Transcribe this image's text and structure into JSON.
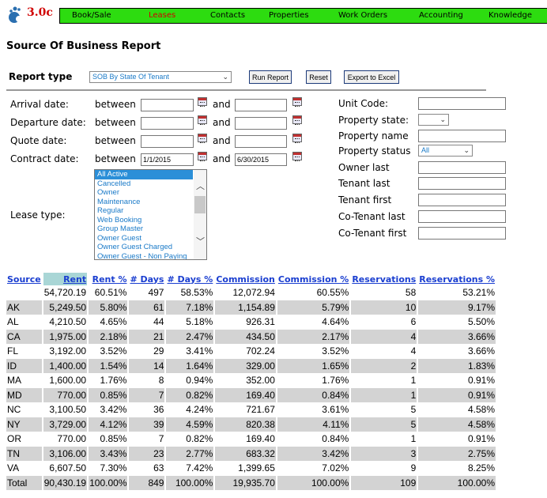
{
  "app": {
    "version": "3.0c"
  },
  "nav": [
    {
      "label": "Book/Sale"
    },
    {
      "label": "Leases",
      "active": true
    },
    {
      "label": "Contacts"
    },
    {
      "label": "Properties"
    },
    {
      "label": "Work Orders"
    },
    {
      "label": "Accounting"
    },
    {
      "label": "Knowledge"
    }
  ],
  "page_title": "Source Of Business Report",
  "report_type": {
    "label": "Report type",
    "value": "SOB By State Of Tenant",
    "run": "Run Report",
    "reset": "Reset",
    "export": "Export to Excel"
  },
  "dates": {
    "between": "between",
    "and": "and",
    "rows": [
      {
        "label": "Arrival date:",
        "from": "",
        "to": ""
      },
      {
        "label": "Departure date:",
        "from": "",
        "to": ""
      },
      {
        "label": "Quote date:",
        "from": "",
        "to": ""
      },
      {
        "label": "Contract date:",
        "from": "1/1/2015",
        "to": "6/30/2015"
      }
    ]
  },
  "lease_type": {
    "label": "Lease type:",
    "options": [
      "All Active",
      "Cancelled",
      "Owner",
      "Maintenance",
      "Regular",
      "Web Booking",
      "Group Master",
      "Owner Guest",
      "Owner Guest Charged",
      "Owner Guest - Non Paying"
    ],
    "selected": "All Active"
  },
  "right_fields": {
    "unit_code": "Unit Code:",
    "property_state": "Property state:",
    "property_name": "Property name",
    "property_status": "Property status",
    "property_status_value": "All",
    "owner_last": "Owner last",
    "tenant_last": "Tenant last",
    "tenant_first": "Tenant first",
    "cotenant_last": "Co-Tenant last",
    "cotenant_first": "Co-Tenant first"
  },
  "table": {
    "headers": [
      "Source",
      "Rent",
      "Rent %",
      "# Days",
      "# Days %",
      "Commission",
      "Commission %",
      "Reservations",
      "Reservations %"
    ],
    "rows": [
      [
        "",
        "54,720.19",
        "60.51%",
        "497",
        "58.53%",
        "12,072.94",
        "60.55%",
        "58",
        "53.21%"
      ],
      [
        "AK",
        "5,249.50",
        "5.80%",
        "61",
        "7.18%",
        "1,154.89",
        "5.79%",
        "10",
        "9.17%"
      ],
      [
        "AL",
        "4,210.50",
        "4.65%",
        "44",
        "5.18%",
        "926.31",
        "4.64%",
        "6",
        "5.50%"
      ],
      [
        "CA",
        "1,975.00",
        "2.18%",
        "21",
        "2.47%",
        "434.50",
        "2.17%",
        "4",
        "3.66%"
      ],
      [
        "FL",
        "3,192.00",
        "3.52%",
        "29",
        "3.41%",
        "702.24",
        "3.52%",
        "4",
        "3.66%"
      ],
      [
        "ID",
        "1,400.00",
        "1.54%",
        "14",
        "1.64%",
        "329.00",
        "1.65%",
        "2",
        "1.83%"
      ],
      [
        "MA",
        "1,600.00",
        "1.76%",
        "8",
        "0.94%",
        "352.00",
        "1.76%",
        "1",
        "0.91%"
      ],
      [
        "MD",
        "770.00",
        "0.85%",
        "7",
        "0.82%",
        "169.40",
        "0.84%",
        "1",
        "0.91%"
      ],
      [
        "NC",
        "3,100.50",
        "3.42%",
        "36",
        "4.24%",
        "721.67",
        "3.61%",
        "5",
        "4.58%"
      ],
      [
        "NY",
        "3,729.00",
        "4.12%",
        "39",
        "4.59%",
        "820.38",
        "4.11%",
        "5",
        "4.58%"
      ],
      [
        "OR",
        "770.00",
        "0.85%",
        "7",
        "0.82%",
        "169.40",
        "0.84%",
        "1",
        "0.91%"
      ],
      [
        "TN",
        "3,106.00",
        "3.43%",
        "23",
        "2.77%",
        "683.32",
        "3.42%",
        "3",
        "2.75%"
      ],
      [
        "VA",
        "6,607.50",
        "7.30%",
        "63",
        "7.42%",
        "1,399.65",
        "7.02%",
        "9",
        "8.25%"
      ],
      [
        "Total",
        "90,430.19",
        "100.00%",
        "849",
        "100.00%",
        "19,935.70",
        "100.00%",
        "109",
        "100.00%"
      ]
    ]
  },
  "colors": {
    "nav": "#2ddc10",
    "active_nav": "#d00000",
    "link": "#1a3ed0",
    "row_alt": "#d3d3d3"
  }
}
